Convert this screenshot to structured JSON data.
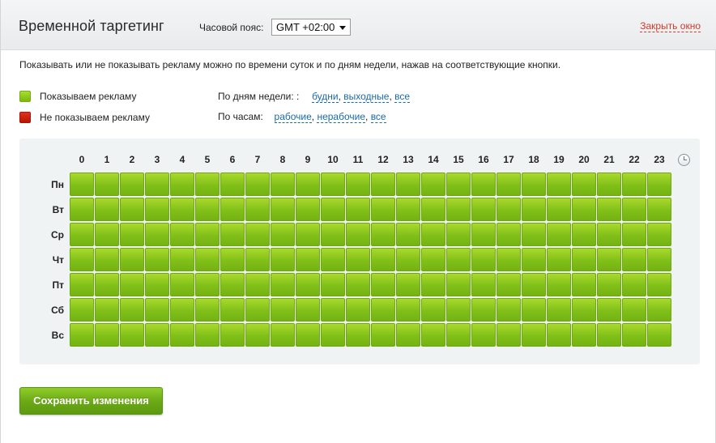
{
  "header": {
    "title": "Временной таргетинг",
    "timezone_label": "Часовой пояс:",
    "timezone_value": "GMT +02:00",
    "close_label": "Закрыть окно"
  },
  "intro": "Показывать или не показывать рекламу можно по времени суток и по дням недели, нажав на соответствующие кнопки.",
  "legend": {
    "show_label": "Показываем рекламу",
    "hide_label": "Не показываем рекламу",
    "show_color": "#8bc61d",
    "hide_color": "#cc2210"
  },
  "filters": {
    "days_label": "По дням недели: :",
    "days_links": [
      "будни",
      "выходные",
      "все"
    ],
    "hours_label": "По часам:",
    "hours_links": [
      "рабочие",
      "нерабочие",
      "все"
    ]
  },
  "grid": {
    "hours": [
      "0",
      "1",
      "2",
      "3",
      "4",
      "5",
      "6",
      "7",
      "8",
      "9",
      "10",
      "11",
      "12",
      "13",
      "14",
      "15",
      "16",
      "17",
      "18",
      "19",
      "20",
      "21",
      "22",
      "23"
    ],
    "days": [
      "Пн",
      "Вт",
      "Ср",
      "Чт",
      "Пт",
      "Сб",
      "Вс"
    ],
    "cell_state": "show",
    "clock_icon": "clock-icon"
  },
  "save_label": "Сохранить изменения"
}
